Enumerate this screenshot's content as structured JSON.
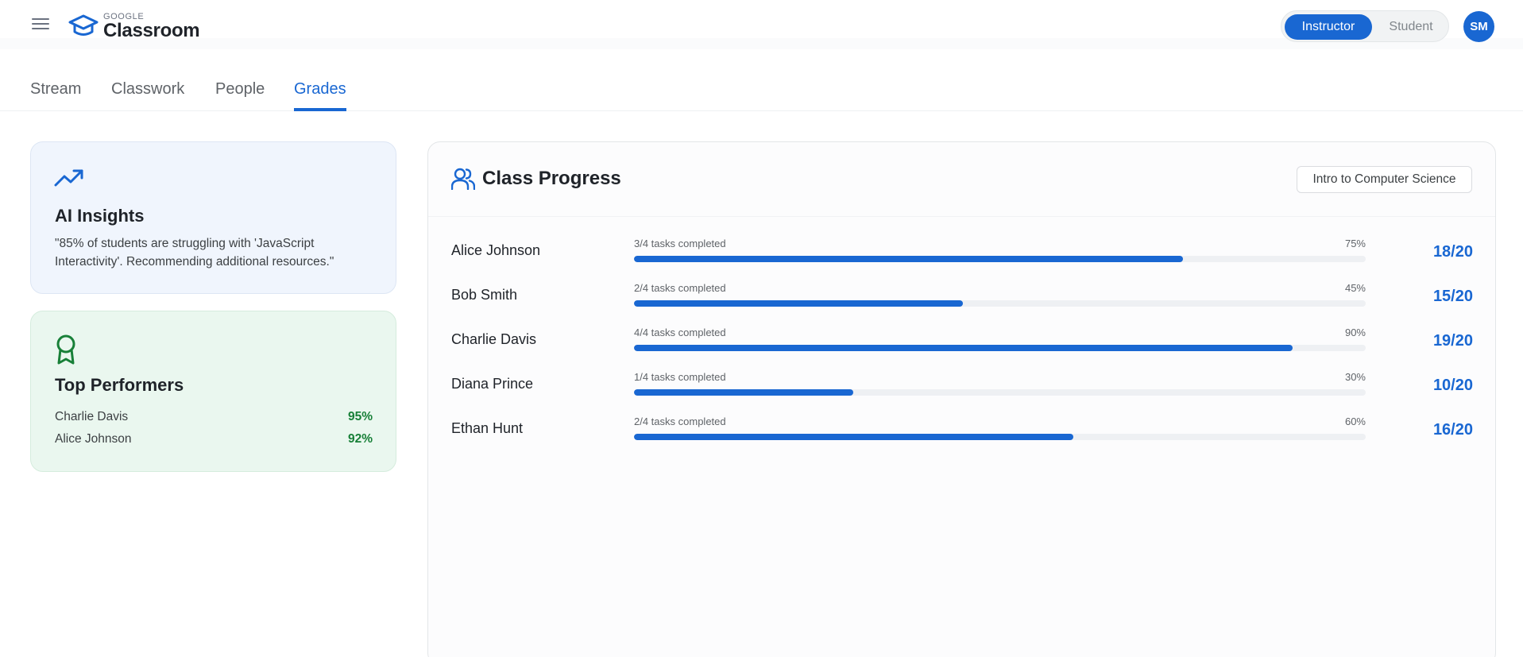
{
  "header": {
    "logo_small": "GOOGLE",
    "logo_big": "Classroom",
    "role_active": "Instructor",
    "role_inactive": "Student",
    "avatar_initials": "SM"
  },
  "tabs": [
    {
      "label": "Stream"
    },
    {
      "label": "Classwork"
    },
    {
      "label": "People"
    },
    {
      "label": "Grades",
      "active": true
    }
  ],
  "ai_insights": {
    "icon": "trending-up-icon",
    "title": "AI Insights",
    "text": "\"85% of students are struggling with 'JavaScript Interactivity'. Recommending additional resources.\""
  },
  "top_performers": {
    "icon": "award-icon",
    "title": "Top Performers",
    "items": [
      {
        "name": "Charlie Davis",
        "score": "95%"
      },
      {
        "name": "Alice Johnson",
        "score": "92%"
      }
    ]
  },
  "class_progress": {
    "icon": "users-icon",
    "title": "Class Progress",
    "course": "Intro to Computer Science",
    "students": [
      {
        "name": "Alice Johnson",
        "tasks": "3/4 tasks completed",
        "percent_label": "75%",
        "progress": 0.75,
        "grade": "18/20"
      },
      {
        "name": "Bob Smith",
        "tasks": "2/4 tasks completed",
        "percent_label": "45%",
        "progress": 0.45,
        "grade": "15/20"
      },
      {
        "name": "Charlie Davis",
        "tasks": "4/4 tasks completed",
        "percent_label": "90%",
        "progress": 0.9,
        "grade": "19/20"
      },
      {
        "name": "Diana Prince",
        "tasks": "1/4 tasks completed",
        "percent_label": "30%",
        "progress": 0.3,
        "grade": "10/20"
      },
      {
        "name": "Ethan Hunt",
        "tasks": "2/4 tasks completed",
        "percent_label": "60%",
        "progress": 0.6,
        "grade": "16/20"
      }
    ]
  },
  "colors": {
    "accent": "#1967d2",
    "success": "#188038"
  }
}
